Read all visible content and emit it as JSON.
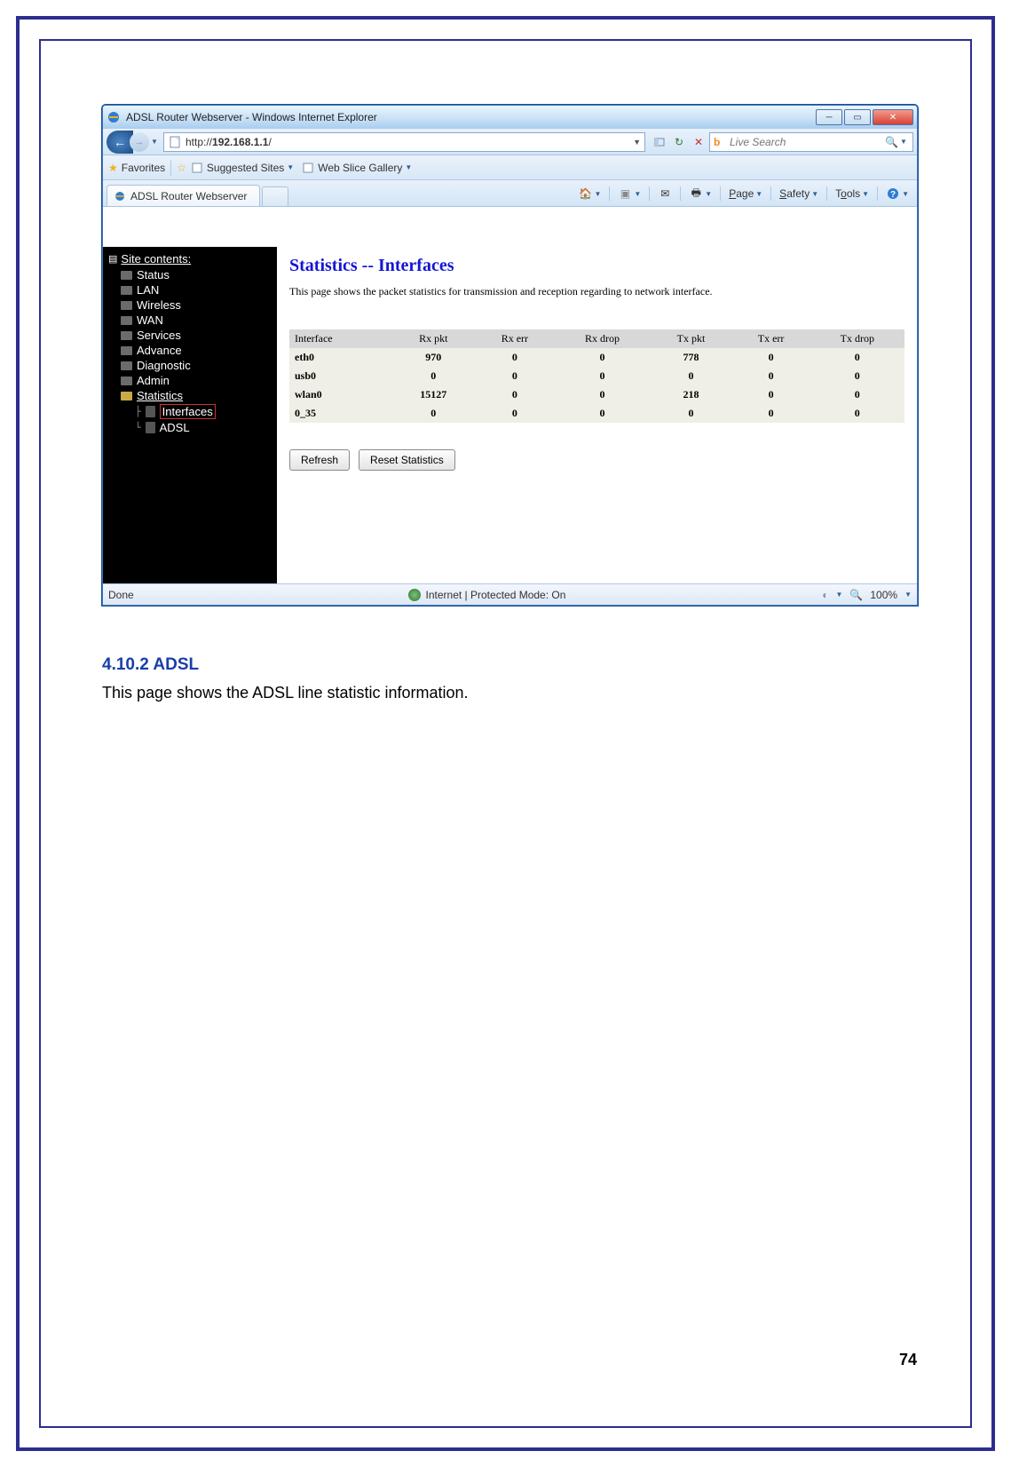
{
  "browser": {
    "window_title": "ADSL Router Webserver - Windows Internet Explorer",
    "url": "http://192.168.1.1/",
    "url_prefix": "http://",
    "url_host": "192.168.1.1",
    "url_suffix": "/",
    "search_placeholder": "Live Search",
    "favorites_label": "Favorites",
    "suggested_sites": "Suggested Sites",
    "web_slice": "Web Slice Gallery",
    "tab_title": "ADSL Router Webserver",
    "cmd_page": "Page",
    "cmd_safety": "Safety",
    "cmd_tools": "Tools",
    "status_left": "Done",
    "status_center": "Internet | Protected Mode: On",
    "zoom": "100%"
  },
  "sidebar": {
    "title": "Site contents:",
    "items": [
      "Status",
      "LAN",
      "Wireless",
      "WAN",
      "Services",
      "Advance",
      "Diagnostic",
      "Admin",
      "Statistics"
    ],
    "stat_children": [
      "Interfaces",
      "ADSL"
    ]
  },
  "stats": {
    "title": "Statistics -- Interfaces",
    "desc": "This page shows the packet statistics for transmission and reception regarding to network interface.",
    "headers": [
      "Interface",
      "Rx pkt",
      "Rx err",
      "Rx drop",
      "Tx pkt",
      "Tx err",
      "Tx drop"
    ],
    "rows": [
      {
        "if": "eth0",
        "rxp": "970",
        "rxe": "0",
        "rxd": "0",
        "txp": "778",
        "txe": "0",
        "txd": "0"
      },
      {
        "if": "usb0",
        "rxp": "0",
        "rxe": "0",
        "rxd": "0",
        "txp": "0",
        "txe": "0",
        "txd": "0"
      },
      {
        "if": "wlan0",
        "rxp": "15127",
        "rxe": "0",
        "rxd": "0",
        "txp": "218",
        "txe": "0",
        "txd": "0"
      },
      {
        "if": "0_35",
        "rxp": "0",
        "rxe": "0",
        "rxd": "0",
        "txp": "0",
        "txe": "0",
        "txd": "0"
      }
    ],
    "refresh": "Refresh",
    "reset": "Reset Statistics"
  },
  "doc": {
    "heading": "4.10.2 ADSL",
    "text": "This page shows the ADSL line statistic information.",
    "page_number": "74"
  }
}
